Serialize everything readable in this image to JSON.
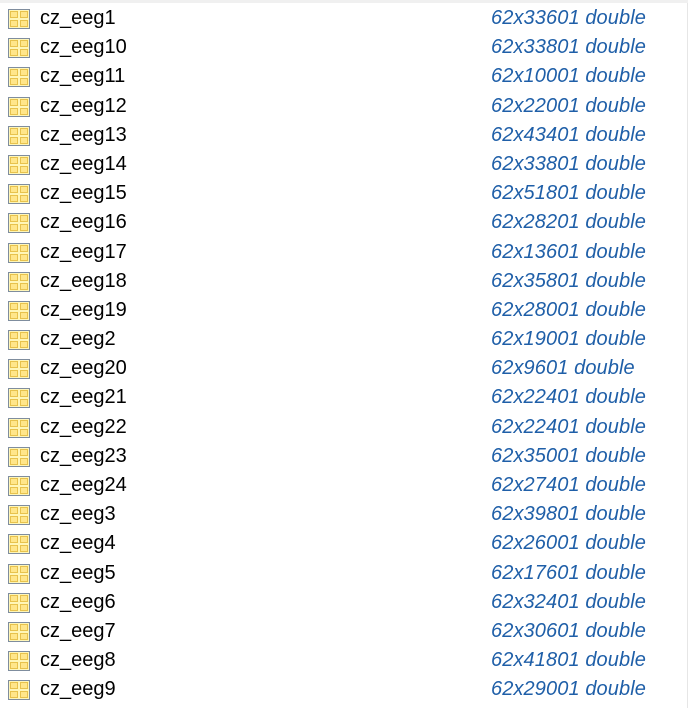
{
  "colors": {
    "name_text": "#000000",
    "value_text": "#1f5fa8",
    "icon_fill": "#ffe68a",
    "icon_border": "#7f8d9e"
  },
  "icons": {
    "variable_icon": "matrix-grid-icon"
  },
  "variables": [
    {
      "name": "cz_eeg1",
      "value": "62x33601 double"
    },
    {
      "name": "cz_eeg10",
      "value": "62x33801 double"
    },
    {
      "name": "cz_eeg11",
      "value": "62x10001 double"
    },
    {
      "name": "cz_eeg12",
      "value": "62x22001 double"
    },
    {
      "name": "cz_eeg13",
      "value": "62x43401 double"
    },
    {
      "name": "cz_eeg14",
      "value": "62x33801 double"
    },
    {
      "name": "cz_eeg15",
      "value": "62x51801 double"
    },
    {
      "name": "cz_eeg16",
      "value": "62x28201 double"
    },
    {
      "name": "cz_eeg17",
      "value": "62x13601 double"
    },
    {
      "name": "cz_eeg18",
      "value": "62x35801 double"
    },
    {
      "name": "cz_eeg19",
      "value": "62x28001 double"
    },
    {
      "name": "cz_eeg2",
      "value": "62x19001 double"
    },
    {
      "name": "cz_eeg20",
      "value": "62x9601 double"
    },
    {
      "name": "cz_eeg21",
      "value": "62x22401 double"
    },
    {
      "name": "cz_eeg22",
      "value": "62x22401 double"
    },
    {
      "name": "cz_eeg23",
      "value": "62x35001 double"
    },
    {
      "name": "cz_eeg24",
      "value": "62x27401 double"
    },
    {
      "name": "cz_eeg3",
      "value": "62x39801 double"
    },
    {
      "name": "cz_eeg4",
      "value": "62x26001 double"
    },
    {
      "name": "cz_eeg5",
      "value": "62x17601 double"
    },
    {
      "name": "cz_eeg6",
      "value": "62x32401 double"
    },
    {
      "name": "cz_eeg7",
      "value": "62x30601 double"
    },
    {
      "name": "cz_eeg8",
      "value": "62x41801 double"
    },
    {
      "name": "cz_eeg9",
      "value": "62x29001 double"
    }
  ]
}
